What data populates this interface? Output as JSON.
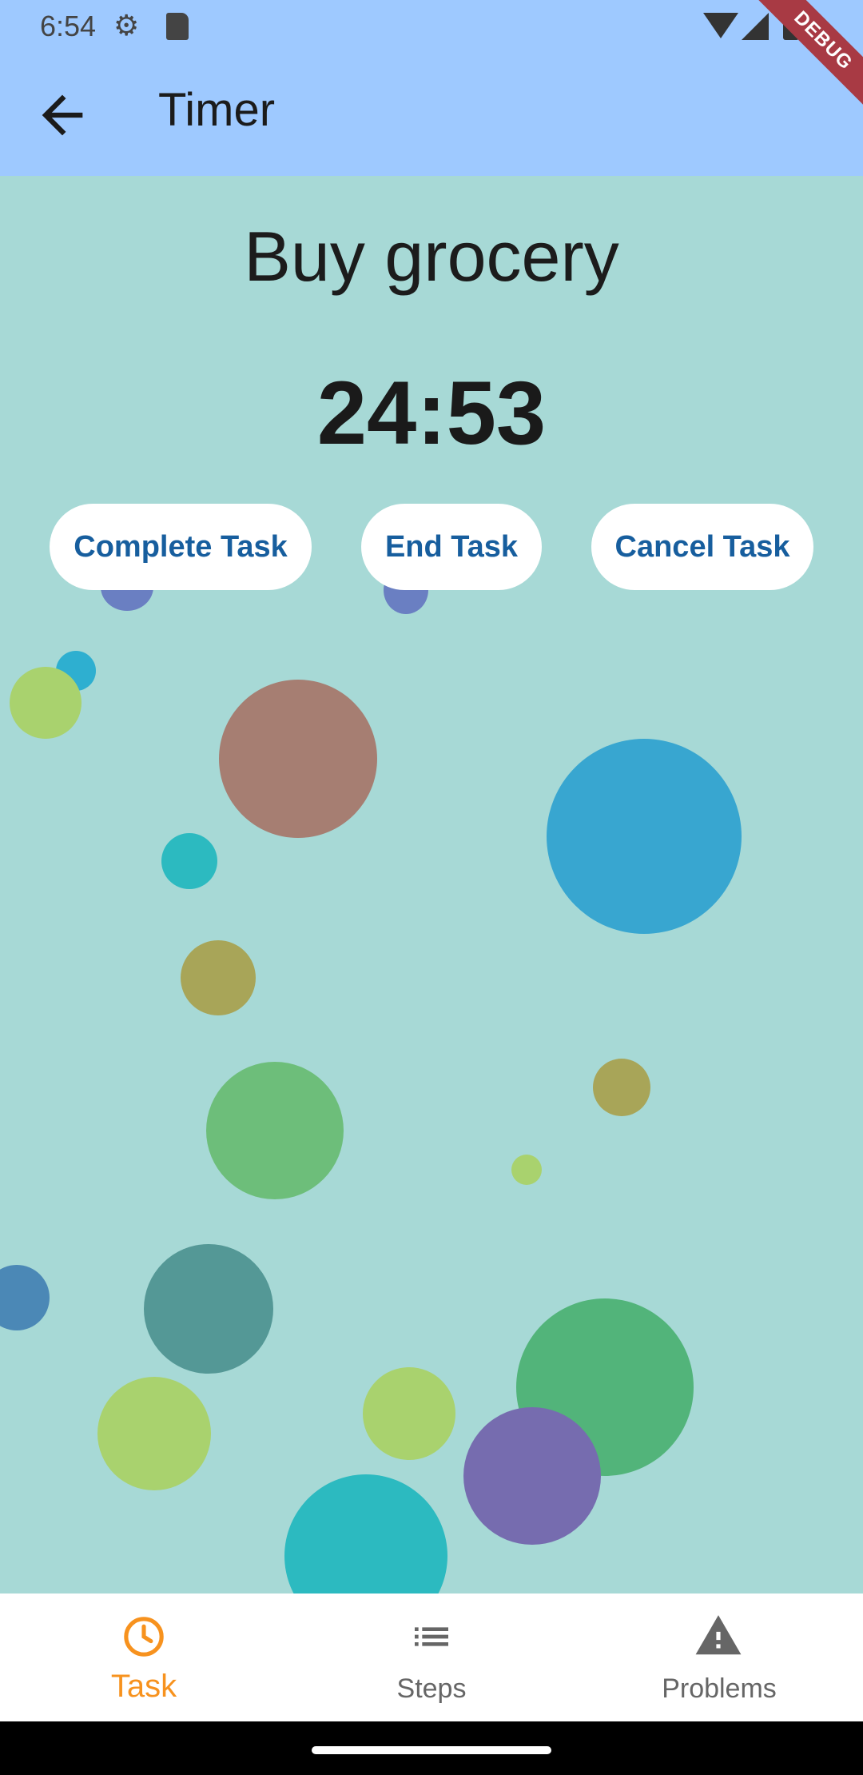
{
  "status_bar": {
    "time": "6:54",
    "icons": [
      "settings-icon",
      "sd-card-icon",
      "wifi-icon",
      "signal-icon",
      "battery-icon"
    ]
  },
  "app_bar": {
    "title": "Timer",
    "back_icon": "arrow-back-icon",
    "background": "#9EC9FF"
  },
  "debug_banner": {
    "label": "DEBUG",
    "color": "#A83A44"
  },
  "main": {
    "task_name": "Buy grocery",
    "timer": "24:53",
    "background": "#A7D9D6",
    "actions": [
      {
        "label": "Complete Task"
      },
      {
        "label": "End Task"
      },
      {
        "label": "Cancel Task"
      }
    ],
    "button_text_color": "#175E9E"
  },
  "bottom_nav": {
    "items": [
      {
        "label": "Task",
        "icon": "clock-icon",
        "active": true
      },
      {
        "label": "Steps",
        "icon": "list-icon",
        "active": false
      },
      {
        "label": "Problems",
        "icon": "warning-icon",
        "active": false
      }
    ],
    "active_color": "#F7921E",
    "inactive_color": "#666666"
  }
}
